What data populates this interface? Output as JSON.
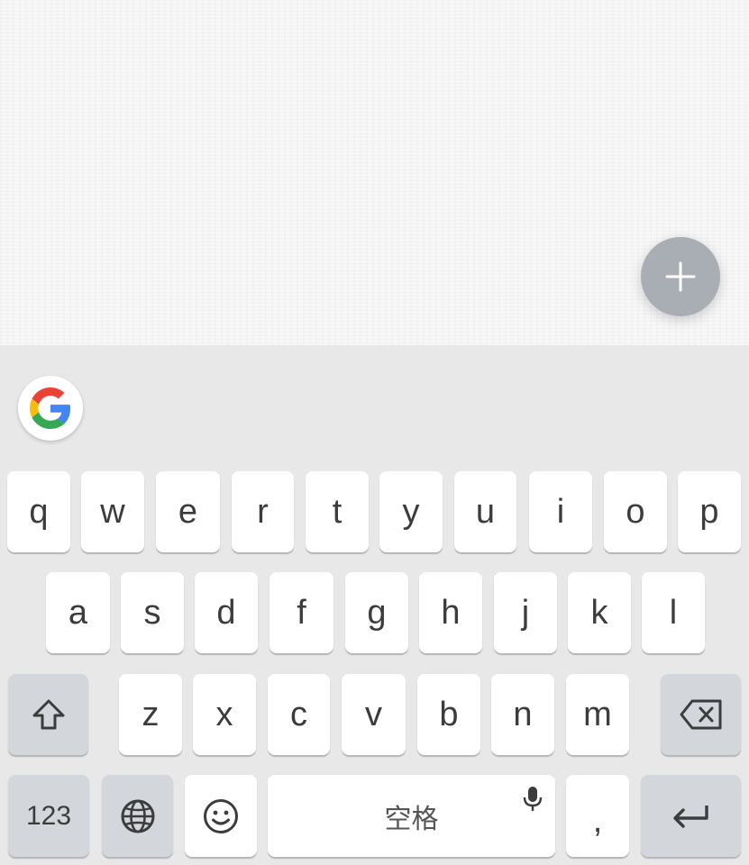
{
  "fab": {
    "icon": "plus-icon"
  },
  "suggestion_bar": {
    "google_icon": "google-g-icon"
  },
  "keyboard": {
    "row1": [
      "q",
      "w",
      "e",
      "r",
      "t",
      "y",
      "u",
      "i",
      "o",
      "p"
    ],
    "row2": [
      "a",
      "s",
      "d",
      "f",
      "g",
      "h",
      "j",
      "k",
      "l"
    ],
    "row3": [
      "z",
      "x",
      "c",
      "v",
      "b",
      "n",
      "m"
    ],
    "shift_icon": "shift-icon",
    "backspace_icon": "backspace-icon",
    "numbers_label": "123",
    "globe_icon": "globe-icon",
    "emoji_icon": "emoji-icon",
    "space_label": "空格",
    "mic_icon": "mic-icon",
    "comma_label": ",",
    "enter_icon": "enter-icon"
  },
  "colors": {
    "keyboard_bg": "#e8e8e8",
    "key_bg": "#ffffff",
    "function_key_bg": "#d3d6da",
    "fab_bg": "#a9aeb4"
  }
}
